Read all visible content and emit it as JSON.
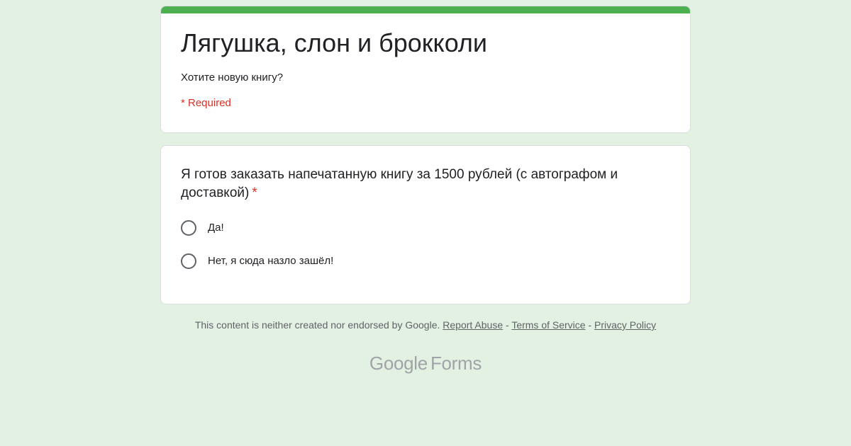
{
  "form": {
    "title": "Лягушка, слон и брокколи",
    "description": "Хотите новую книгу?",
    "required_note": "* Required"
  },
  "question": {
    "text": "Я готов заказать напечатанную книгу за 1500 рублей (с автографом и доставкой)",
    "asterisk": "*",
    "options": [
      {
        "label": "Да!"
      },
      {
        "label": "Нет, я сюда назло зашёл!"
      }
    ]
  },
  "footer": {
    "disclaimer": "This content is neither created nor endorsed by Google.",
    "report_abuse": "Report Abuse",
    "separator": "-",
    "terms": "Terms of Service",
    "privacy": "Privacy Policy"
  },
  "logo": {
    "brand": "Google",
    "product": "Forms"
  },
  "colors": {
    "background": "#e3f1e3",
    "accent": "#4caf50",
    "required": "#d93025"
  }
}
